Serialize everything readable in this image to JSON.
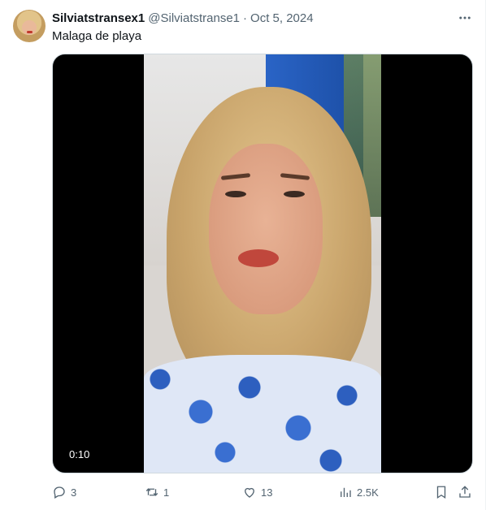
{
  "tweet": {
    "author_name": "Silviatstransex1",
    "author_handle": "@Silviatstranse1",
    "separator": "·",
    "date": "Oct 5, 2024",
    "text": "Malaga de playa"
  },
  "media": {
    "duration": "0:10"
  },
  "actions": {
    "replies": "3",
    "reposts": "1",
    "likes": "13",
    "views": "2.5K"
  },
  "icons": {
    "more": "more-horizontal-icon",
    "reply": "reply-icon",
    "repost": "repost-icon",
    "like": "heart-icon",
    "views": "analytics-icon",
    "bookmark": "bookmark-icon",
    "share": "share-icon"
  },
  "colors": {
    "text_primary": "#0f1419",
    "text_secondary": "#536471",
    "border": "#cfd9de"
  }
}
